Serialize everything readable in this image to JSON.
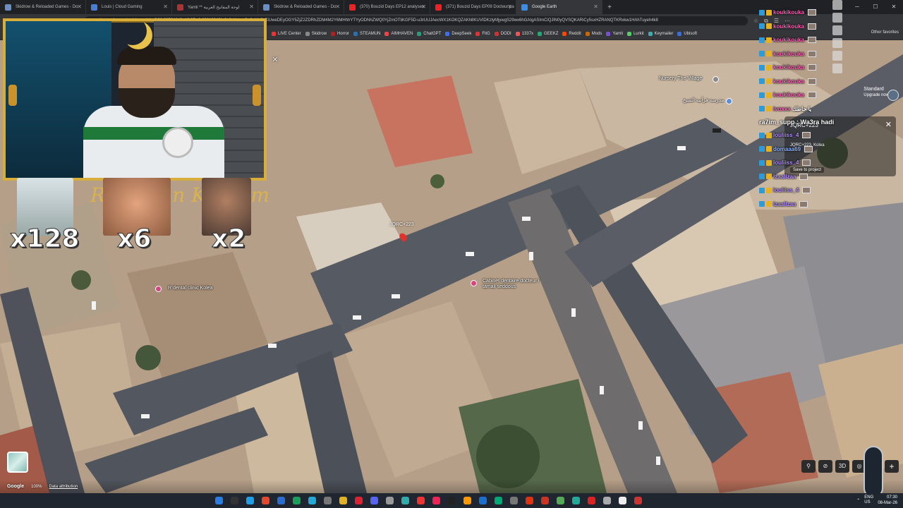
{
  "browser": {
    "tabs": [
      {
        "label": "Skidrow & Reloaded Games - Do",
        "fav": "#6b8ec5",
        "active": false
      },
      {
        "label": "Louis | Cloud Gaming",
        "fav": "#4a7bd6",
        "active": false
      },
      {
        "label": "Yamli ** لوحة المفاتيح العربية",
        "fav": "#a33",
        "active": false
      },
      {
        "label": "Skidrow & Reloaded Games - Do",
        "fav": "#6b8ec5",
        "active": false
      },
      {
        "label": "(370) Bouzid Days EP12 analyses",
        "fav": "#e22",
        "active": false
      },
      {
        "label": "(371) Bouzid Days EP09 Docteur pa",
        "fav": "#e22",
        "active": false
      },
      {
        "label": "Google Earth",
        "fav": "#3a8ee6",
        "active": true
      }
    ],
    "address": "earth.google.com/web/search/...@36.36501243_10.35y,0.00013346h,0t,0r/data=Cn8aUhJLCiUweDEyOGY5ZjZ2ZDRhZDM4M2Y6MHhhYTYyODNhZWQ0YjZmOTliKGF5D-u3rUUJAecWX1KOKQZAKh8KUVIDKzlyMjywgS29wx6hGAIgASImCiQJlN0yQVSQKARiCy5sxHZRANQTKRxkw1HAhTuyeh4k8",
    "bookmarks": [
      {
        "label": "LIVE Center",
        "c": "#e33"
      },
      {
        "label": "Skidrow",
        "c": "#888"
      },
      {
        "label": "Horror",
        "c": "#a22"
      },
      {
        "label": "STEAMUN",
        "c": "#2a6fb0"
      },
      {
        "label": "AIMHAVEN",
        "c": "#e44"
      },
      {
        "label": "ChatGPT",
        "c": "#2b9c7a"
      },
      {
        "label": "DeepSeek",
        "c": "#3b6ef2"
      },
      {
        "label": "FitG",
        "c": "#d33"
      },
      {
        "label": "DODI",
        "c": "#c33"
      },
      {
        "label": "1337x",
        "c": "#e55"
      },
      {
        "label": "GEEKZ",
        "c": "#2a7"
      },
      {
        "label": "Reddit",
        "c": "#ff4500"
      },
      {
        "label": "Mods",
        "c": "#c60"
      },
      {
        "label": "Yamli",
        "c": "#7a4fd6"
      },
      {
        "label": "Lurkit",
        "c": "#5c6"
      },
      {
        "label": "Keymailer",
        "c": "#4aa"
      },
      {
        "label": "Ubisoft",
        "c": "#3a6ed6"
      }
    ],
    "other_favorites": "Other favorites"
  },
  "earth": {
    "account_plan": "Standard",
    "upgrade": "Upgrade now",
    "place": {
      "title": "JQRC+223",
      "subtitle": "JQRC+223, Kolea",
      "save": "Save to project"
    },
    "pin_label": "JQRC+223",
    "labels": {
      "nursery": "Nursery The Village",
      "dental1": "R dental clinic Kolea",
      "dental2": "Cabinet dentaire docteur / tamali seddous",
      "school": "مدرسة قرآنية الشيخ"
    },
    "attribution": {
      "google": "Google",
      "zoom": "100%",
      "data": "Data attribution"
    },
    "controls": [
      "⚲",
      "⊘",
      "3D",
      "◎"
    ]
  },
  "overlay": {
    "counters": [
      "x128",
      "x6",
      "x2"
    ],
    "ramadan_text": "Ramadan Kareem",
    "chat": [
      {
        "user": "koukikouka",
        "color": "name-pink"
      },
      {
        "user": "koukikouka",
        "color": "name-pink"
      },
      {
        "user": "koukikouka",
        "color": "name-pink"
      },
      {
        "user": "koukikouka",
        "color": "name-pink"
      },
      {
        "user": "koukikouka",
        "color": "name-pink"
      },
      {
        "user": "koukikouka",
        "color": "name-pink"
      },
      {
        "user": "koukikouka",
        "color": "name-pink"
      },
      {
        "user": "ivoxxx",
        "color": "name-pink",
        "msg": "يا حاطك"
      }
    ],
    "chat_message": {
      "user": "ra7im_supp",
      "text": "Wa3ra hadi"
    },
    "chat2": [
      {
        "user": "louliiss_4",
        "color": "name-purple"
      },
      {
        "user": "domaaa69",
        "color": "name-blue"
      },
      {
        "user": "louliiss_4",
        "color": "name-purple"
      },
      {
        "user": "lzaallzaa",
        "color": "name-purple"
      },
      {
        "user": "louliiss_4",
        "color": "name-purple"
      },
      {
        "user": "lzaallzaa",
        "color": "name-purple"
      }
    ]
  },
  "taskbar": {
    "lang": "ENG\nUS",
    "time": "07:30",
    "date": "08-Mar-26"
  }
}
